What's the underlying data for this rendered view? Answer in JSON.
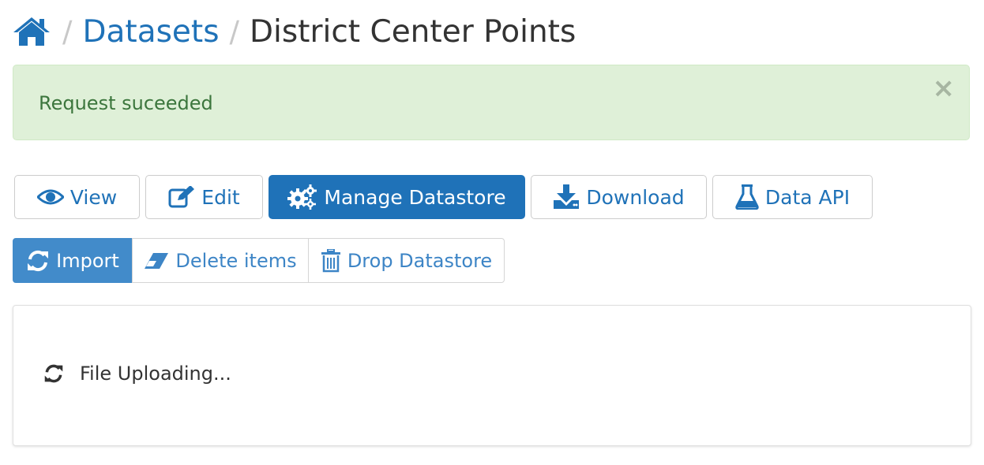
{
  "breadcrumb": {
    "home_icon": "home-icon",
    "separator": "/",
    "datasets": "Datasets",
    "current": "District Center Points"
  },
  "alert": {
    "message": "Request suceeded",
    "close": "×"
  },
  "nav_buttons": [
    {
      "label": "View",
      "icon": "eye-icon",
      "active": false
    },
    {
      "label": "Edit",
      "icon": "edit-icon",
      "active": false
    },
    {
      "label": "Manage Datastore",
      "icon": "gears-icon",
      "active": true
    },
    {
      "label": "Download",
      "icon": "download-icon",
      "active": false
    },
    {
      "label": "Data API",
      "icon": "flask-icon",
      "active": false
    }
  ],
  "sub_buttons": [
    {
      "label": "Import",
      "icon": "refresh-icon",
      "active": true
    },
    {
      "label": "Delete items",
      "icon": "eraser-icon",
      "active": false
    },
    {
      "label": "Drop Datastore",
      "icon": "trash-icon",
      "active": false
    }
  ],
  "panel": {
    "status_icon": "refresh-icon",
    "status_text": "File Uploading..."
  },
  "colors": {
    "primary": "#1f72b8",
    "alert_bg": "#dff0d8",
    "alert_text": "#3c763d",
    "active_sub": "#428bca"
  }
}
